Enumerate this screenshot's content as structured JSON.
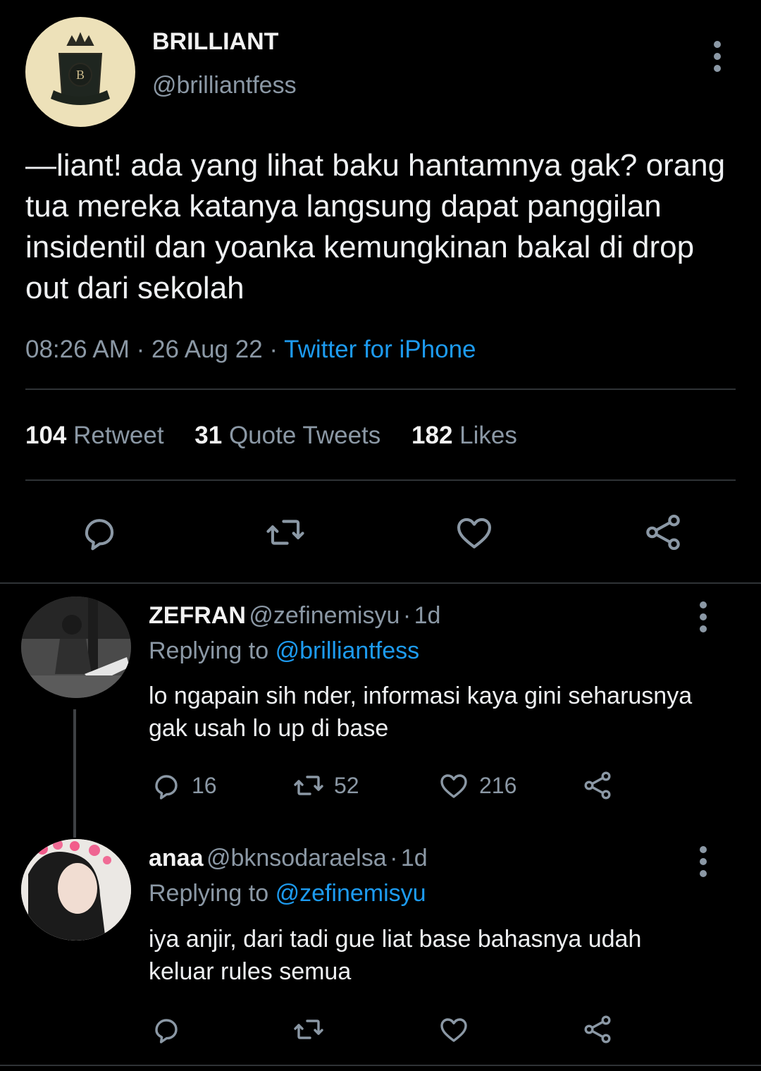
{
  "tweet": {
    "author": {
      "name": "BRILLIANT",
      "handle": "@brilliantfess",
      "avatar_icon": "crest-logo-icon"
    },
    "text": "—liant! ada yang lihat baku hantamnya gak? orang tua mereka katanya langsung dapat panggilan insidentil dan yoanka kemungkinan bakal di drop out dari sekolah",
    "time": "08:26 AM",
    "date": "26 Aug 22",
    "separator": "·",
    "client": "Twitter for iPhone",
    "stats": {
      "retweets_count": "104",
      "retweets_label": "Retweet",
      "quotes_count": "31",
      "quotes_label": "Quote Tweets",
      "likes_count": "182",
      "likes_label": "Likes"
    },
    "actions": [
      "reply-icon",
      "retweet-icon",
      "like-icon",
      "share-icon"
    ]
  },
  "replies": [
    {
      "name": "ZEFRAN",
      "handle": "@zefinemisyu",
      "sep": "·",
      "age": "1d",
      "replying_prefix": "Replying to",
      "replying_to": "@brilliantfess",
      "text": "lo ngapain sih nder, informasi kaya gini seharusnya gak usah lo up di base",
      "reply_count": "16",
      "retweet_count": "52",
      "like_count": "216"
    },
    {
      "name": "anaa",
      "handle": "@bknsodaraelsa",
      "sep": "·",
      "age": "1d",
      "replying_prefix": "Replying to",
      "replying_to": "@zefinemisyu",
      "text": "iya anjir, dari tadi gue liat base bahasnya udah keluar rules semua",
      "reply_count": "",
      "retweet_count": "",
      "like_count": ""
    }
  ],
  "colors": {
    "background": "#000000",
    "accent": "#1d9bf0",
    "muted": "#8b98a5",
    "divider": "#2f3336"
  }
}
